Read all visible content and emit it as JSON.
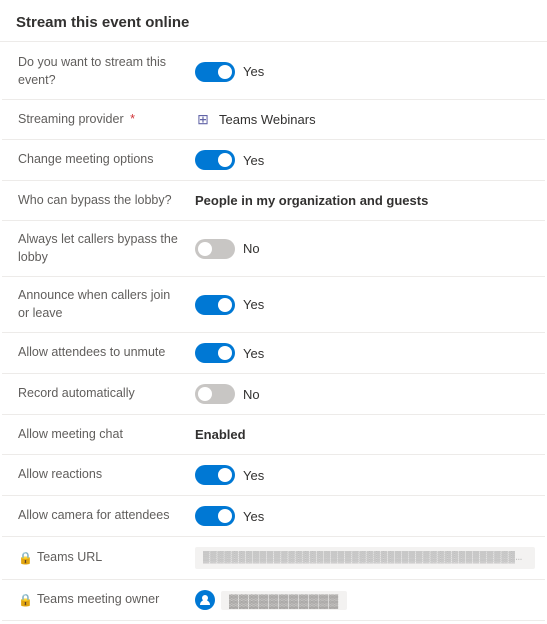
{
  "page": {
    "title": "Stream this event online"
  },
  "rows": [
    {
      "id": "stream-event",
      "label": "Do you want to stream this event?",
      "type": "toggle",
      "state": "on",
      "value_label": "Yes",
      "required": false
    },
    {
      "id": "streaming-provider",
      "label": "Streaming provider",
      "type": "provider",
      "provider_name": "Teams Webinars",
      "required": true
    },
    {
      "id": "change-meeting-options",
      "label": "Change meeting options",
      "type": "toggle",
      "state": "on",
      "value_label": "Yes",
      "required": false
    },
    {
      "id": "bypass-lobby",
      "label": "Who can bypass the lobby?",
      "type": "bold-text",
      "value": "People in my organization and guests",
      "required": false
    },
    {
      "id": "callers-bypass",
      "label": "Always let callers bypass the lobby",
      "type": "toggle",
      "state": "off",
      "value_label": "No",
      "required": false
    },
    {
      "id": "announce-callers",
      "label": "Announce when callers join or leave",
      "type": "toggle",
      "state": "on",
      "value_label": "Yes",
      "required": false
    },
    {
      "id": "allow-unmute",
      "label": "Allow attendees to unmute",
      "type": "toggle",
      "state": "on",
      "value_label": "Yes",
      "required": false
    },
    {
      "id": "record-automatically",
      "label": "Record automatically",
      "type": "toggle",
      "state": "off",
      "value_label": "No",
      "required": false
    },
    {
      "id": "meeting-chat",
      "label": "Allow meeting chat",
      "type": "bold-text",
      "value": "Enabled",
      "required": false
    },
    {
      "id": "allow-reactions",
      "label": "Allow reactions",
      "type": "toggle",
      "state": "on",
      "value_label": "Yes",
      "required": false
    },
    {
      "id": "allow-camera",
      "label": "Allow camera for attendees",
      "type": "toggle",
      "state": "on",
      "value_label": "Yes",
      "required": false
    },
    {
      "id": "teams-url",
      "label": "Teams URL",
      "type": "url",
      "value": "████████████████████████████████████████████████████",
      "has_lock": true
    },
    {
      "id": "teams-meeting-owner",
      "label": "Teams meeting owner",
      "type": "user",
      "value": "███████████",
      "has_lock": true
    }
  ],
  "icons": {
    "lock": "🔒",
    "teams": "⊞",
    "person": "👤"
  }
}
